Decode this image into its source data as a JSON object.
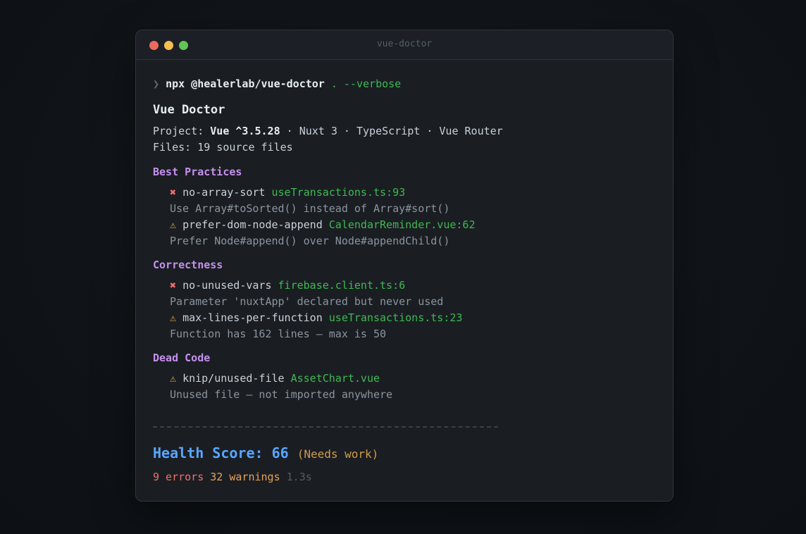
{
  "window": {
    "title": "vue-doctor"
  },
  "command": {
    "chevron": "❯",
    "cmd": "npx @healerlab/vue-doctor",
    "args": " . --verbose"
  },
  "header": {
    "title": "Vue Doctor",
    "project_label": "Project: ",
    "framework": "Vue ^3.5.28",
    "project_rest": " · Nuxt 3 · TypeScript · Vue Router",
    "files": "Files: 19 source files"
  },
  "sections": [
    {
      "title": "Best Practices",
      "issues": [
        {
          "icon": "✖",
          "icon_type": "error",
          "rule": "no-array-sort",
          "location": "useTransactions.ts:93",
          "message": "Use Array#toSorted() instead of Array#sort()"
        },
        {
          "icon": "⚠",
          "icon_type": "warning",
          "rule": "prefer-dom-node-append",
          "location": "CalendarReminder.vue:62",
          "message": "Prefer Node#append() over Node#appendChild()"
        }
      ]
    },
    {
      "title": "Correctness",
      "issues": [
        {
          "icon": "✖",
          "icon_type": "error",
          "rule": "no-unused-vars",
          "location": "firebase.client.ts:6",
          "message": "Parameter 'nuxtApp' declared but never used"
        },
        {
          "icon": "⚠",
          "icon_type": "warning",
          "rule": "max-lines-per-function",
          "location": "useTransactions.ts:23",
          "message": "Function has 162 lines — max is 50"
        }
      ]
    },
    {
      "title": "Dead Code",
      "issues": [
        {
          "icon": "⚠",
          "icon_type": "warning",
          "rule": "knip/unused-file",
          "location": "AssetChart.vue",
          "message": "Unused file — not imported anywhere"
        }
      ]
    }
  ],
  "summary": {
    "score_label": "Health Score: ",
    "score": "66",
    "score_note": "(Needs work)",
    "errors": "9 errors",
    "warnings": "32 warnings",
    "duration": "1.3s"
  },
  "colors": {
    "error": "#f47067",
    "warning": "#d9a441",
    "file": "#3fb950",
    "section": "#c690ec",
    "score": "#58a6ff"
  }
}
